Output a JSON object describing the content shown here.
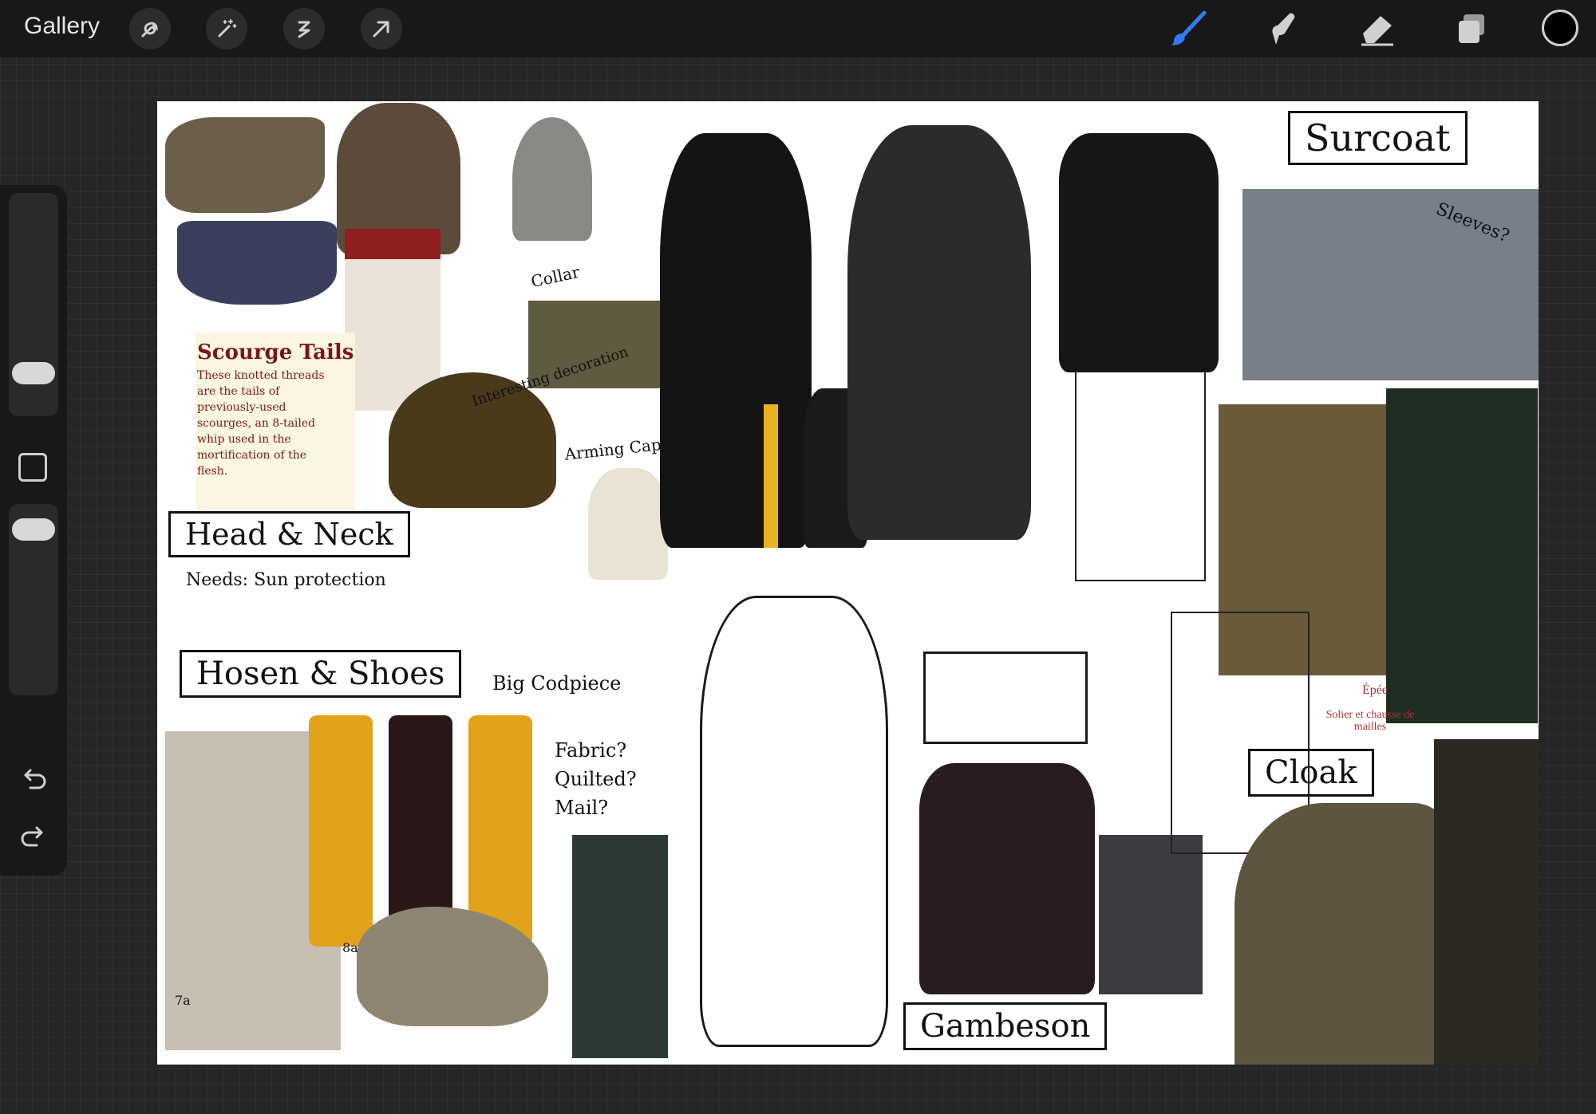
{
  "toolbar": {
    "gallery_label": "Gallery",
    "left_tools": [
      "wrench-icon",
      "magic-wand-icon",
      "selection-icon",
      "transform-arrow-icon"
    ],
    "right_tools": [
      "brush-icon",
      "smudge-icon",
      "eraser-icon",
      "layers-icon"
    ],
    "active_tool": "brush-icon",
    "accent_color": "#2f7cf6",
    "current_color": "#000000"
  },
  "sidebar": {
    "brush_size_level": 0.4,
    "opacity_level": 0.75
  },
  "canvas": {
    "background": "#ffffff",
    "labels": {
      "head_neck": "Head & Neck",
      "needs": "Needs: Sun protection",
      "hosen_shoes": "Hosen & Shoes",
      "big_codpiece": "Big Codpiece",
      "fabric_note": [
        "Fabric?",
        "Quilted?",
        "Mail?"
      ],
      "collar": "Collar",
      "interesting_decoration": "Interesting decoration",
      "arming_cap": "Arming Cap underneath",
      "surcoat": "Surcoat",
      "sleeves": "Sleeves?",
      "cloak": "Cloak",
      "gambeson": "Gambeson",
      "epee": "Épée",
      "solier": "Solier et chausse de mailles",
      "fig_7a": "7a",
      "fig_8a": "8a"
    },
    "scourge": {
      "title": "Scourge Tails",
      "text": "These knotted threads are the tails of previously-used scourges, an 8-tailed whip used in the mortification of the flesh."
    }
  }
}
